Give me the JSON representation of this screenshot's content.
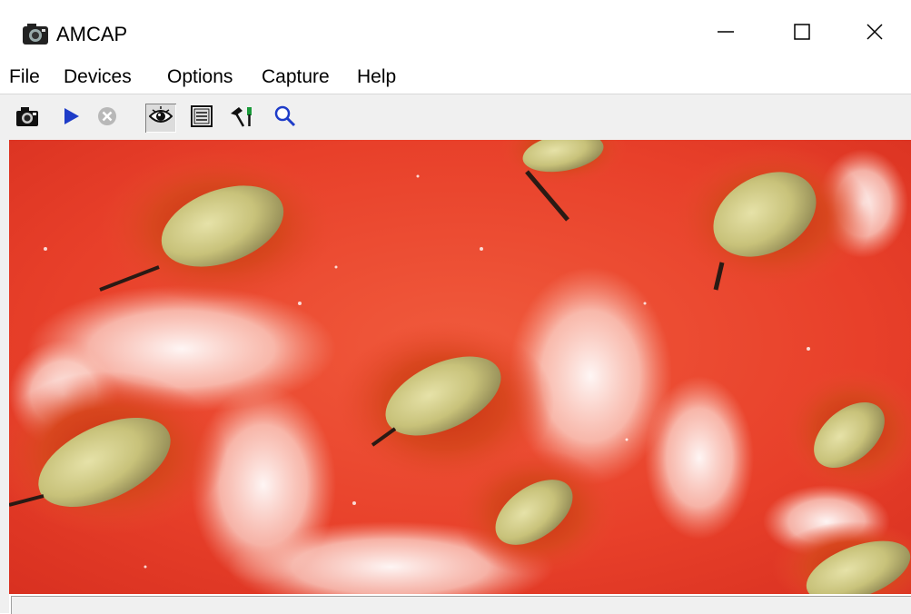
{
  "window": {
    "title": "AMCAP",
    "controls": {
      "minimize": "minimize-icon",
      "maximize": "maximize-icon",
      "close": "close-icon"
    }
  },
  "menu": {
    "items": [
      {
        "label": "File"
      },
      {
        "label": "Devices"
      },
      {
        "label": "Options"
      },
      {
        "label": "Capture"
      },
      {
        "label": "Help"
      }
    ]
  },
  "toolbar": {
    "buttons": [
      {
        "icon": "camera-icon",
        "pressed": false
      },
      {
        "icon": "play-icon",
        "pressed": false
      },
      {
        "icon": "stop-icon",
        "pressed": false,
        "disabled": true
      },
      {
        "icon": "eye-preview-icon",
        "pressed": true
      },
      {
        "icon": "properties-icon",
        "pressed": false
      },
      {
        "icon": "tools-icon",
        "pressed": false
      },
      {
        "icon": "magnifier-icon",
        "pressed": false
      }
    ]
  },
  "preview": {
    "subject": "strawberry-surface-macro"
  },
  "status": {
    "text": ""
  },
  "colors": {
    "window_bg": "#ffffff",
    "toolbar_bg": "#f0f0f0",
    "accent": "#1e3cc8"
  }
}
